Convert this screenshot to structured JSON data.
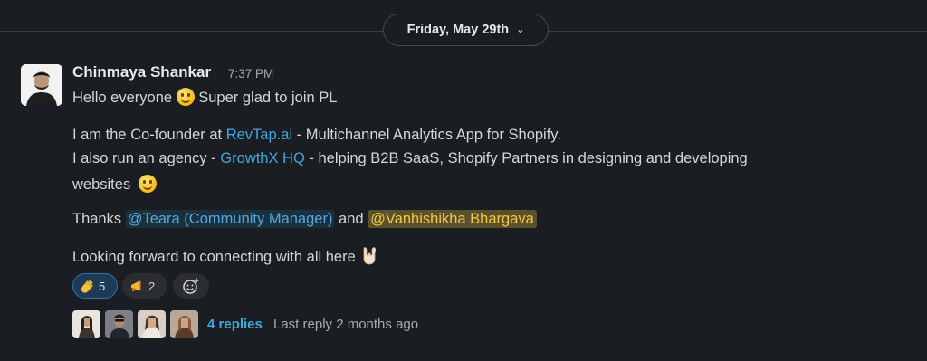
{
  "date_divider": {
    "label": "Friday, May 29th"
  },
  "message": {
    "author": "Chinmaya Shankar",
    "time": "7:37 PM",
    "greeting_pre": "Hello everyone",
    "greeting_post": "Super glad to join PL",
    "p2_pre": "I am the Co-founder at",
    "p2_link": "RevTap.ai",
    "p2_post": "- Multichannel Analytics App for Shopify.",
    "p3_pre": "I also run an agency -",
    "p3_link": "GrowthX HQ",
    "p3_post": "- helping B2B SaaS, Shopify Partners in designing and developing",
    "p3_cont": "websites",
    "thanks_pre": "Thanks",
    "mention_1": "@Teara (Community Manager)",
    "thanks_and": "and",
    "mention_2": "@Vanhishikha Bhargava",
    "closing": "Looking forward to connecting with all here"
  },
  "reactions": [
    {
      "icon": "wave-emoji-icon",
      "count": "5",
      "active": true
    },
    {
      "icon": "megaphone-emoji-icon",
      "count": "2",
      "active": false
    }
  ],
  "thread": {
    "replies_label": "4 replies",
    "last_reply": "Last reply 2 months ago"
  },
  "colors": {
    "background": "#1a1d21",
    "link": "#3fa8e0",
    "mention_highlight": "#f2c744",
    "active_reaction": "#2a74b3"
  }
}
